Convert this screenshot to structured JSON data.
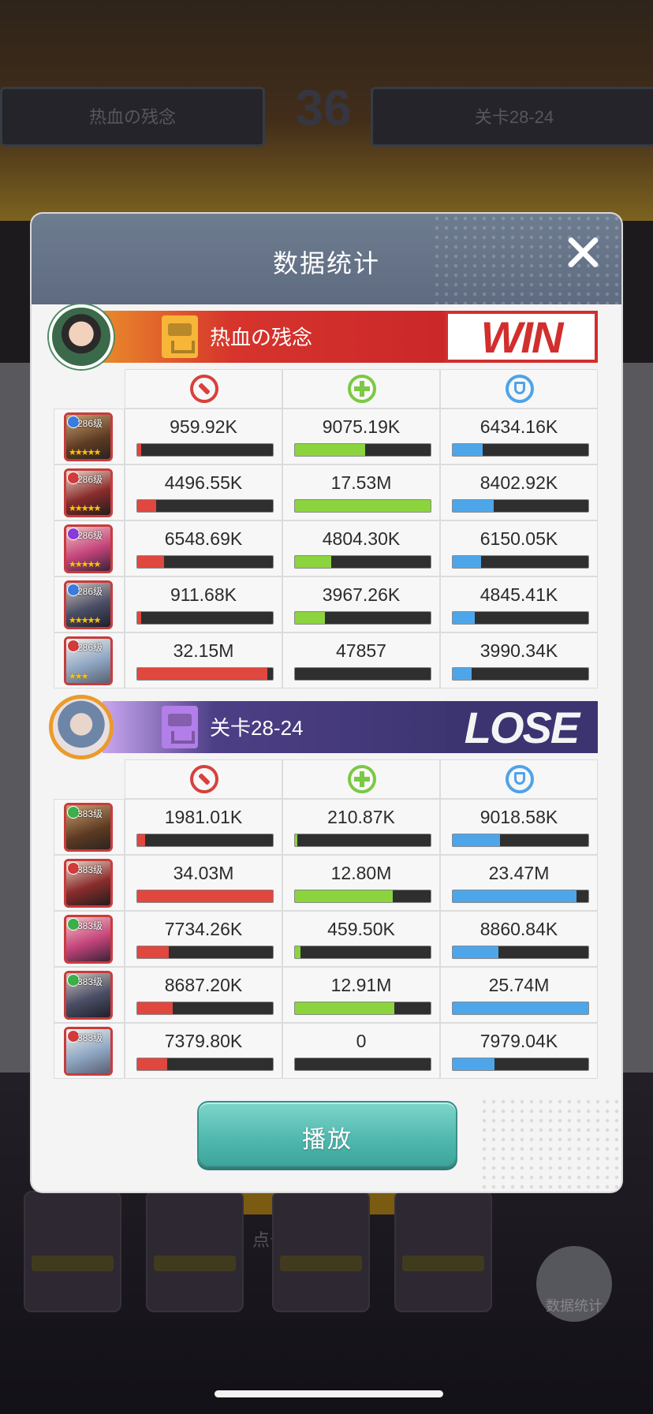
{
  "background": {
    "left_banner": "热血の残念",
    "right_banner": "关卡28-24",
    "score": "36",
    "hint": "点击查看统计",
    "round_button": "数据统计"
  },
  "modal": {
    "title": "数据统计",
    "close_icon": "close-icon",
    "stat_icons": [
      "damage-icon",
      "heal-icon",
      "shield-icon"
    ],
    "play_label": "播放"
  },
  "teams": [
    {
      "name": "热血の残念",
      "result": "WIN",
      "heroes": [
        {
          "level": "286级",
          "class_color": "#3b7be0",
          "stars": "★★★★★",
          "damage": "959.92K",
          "damage_fill": 0.03,
          "heal": "9075.19K",
          "heal_fill": 0.52,
          "shield": "6434.16K",
          "shield_fill": 0.22
        },
        {
          "level": "286级",
          "class_color": "#d23b3b",
          "stars": "★★★★★",
          "damage": "4496.55K",
          "damage_fill": 0.14,
          "heal": "17.53M",
          "heal_fill": 1.0,
          "shield": "8402.92K",
          "shield_fill": 0.3
        },
        {
          "level": "286级",
          "class_color": "#8a3ad8",
          "stars": "★★★★★",
          "damage": "6548.69K",
          "damage_fill": 0.2,
          "heal": "4804.30K",
          "heal_fill": 0.27,
          "shield": "6150.05K",
          "shield_fill": 0.21
        },
        {
          "level": "286级",
          "class_color": "#3b7be0",
          "stars": "★★★★★",
          "damage": "911.68K",
          "damage_fill": 0.03,
          "heal": "3967.26K",
          "heal_fill": 0.22,
          "shield": "4845.41K",
          "shield_fill": 0.16
        },
        {
          "level": "286级",
          "class_color": "#d23b3b",
          "stars": "★★★",
          "damage": "32.15M",
          "damage_fill": 0.96,
          "heal": "47857",
          "heal_fill": 0.0,
          "shield": "3990.34K",
          "shield_fill": 0.14
        }
      ]
    },
    {
      "name": "关卡28-24",
      "result": "LOSE",
      "heroes": [
        {
          "level": "383级",
          "class_color": "#3bb04a",
          "stars": "",
          "damage": "1981.01K",
          "damage_fill": 0.06,
          "heal": "210.87K",
          "heal_fill": 0.02,
          "shield": "9018.58K",
          "shield_fill": 0.35
        },
        {
          "level": "383级",
          "class_color": "#d23b3b",
          "stars": "",
          "damage": "34.03M",
          "damage_fill": 1.0,
          "heal": "12.80M",
          "heal_fill": 0.72,
          "shield": "23.47M",
          "shield_fill": 0.91
        },
        {
          "level": "383级",
          "class_color": "#3bb04a",
          "stars": "",
          "damage": "7734.26K",
          "damage_fill": 0.23,
          "heal": "459.50K",
          "heal_fill": 0.04,
          "shield": "8860.84K",
          "shield_fill": 0.34
        },
        {
          "level": "383级",
          "class_color": "#3bb04a",
          "stars": "",
          "damage": "8687.20K",
          "damage_fill": 0.26,
          "heal": "12.91M",
          "heal_fill": 0.73,
          "shield": "25.74M",
          "shield_fill": 1.0
        },
        {
          "level": "383级",
          "class_color": "#d23b3b",
          "stars": "",
          "damage": "7379.80K",
          "damage_fill": 0.22,
          "heal": "0",
          "heal_fill": 0.0,
          "shield": "7979.04K",
          "shield_fill": 0.31
        }
      ]
    }
  ]
}
